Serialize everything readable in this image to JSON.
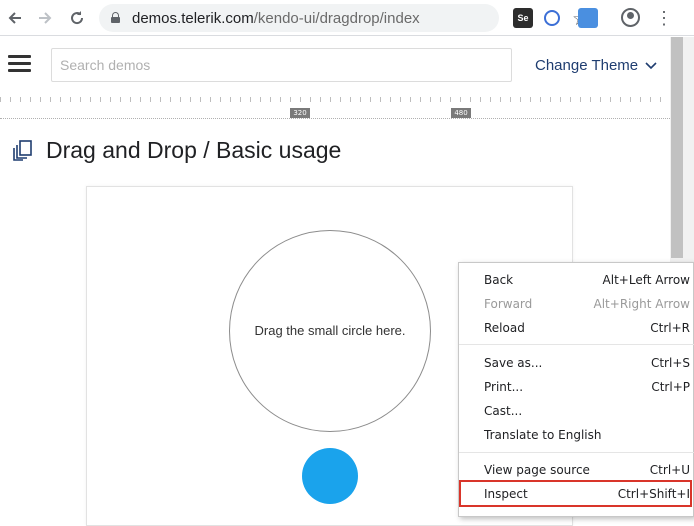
{
  "browser": {
    "url_host": "demos.telerik.com",
    "url_path": "/kendo-ui/dragdrop/index"
  },
  "site_header": {
    "search_placeholder": "Search demos",
    "theme_label": "Change Theme"
  },
  "ruler": {
    "tag_1": "320",
    "tag_2": "480"
  },
  "page": {
    "title": "Drag and Drop / Basic usage",
    "drop_target_label": "Drag the small circle here."
  },
  "colors": {
    "draggable_circle": "#1aa3ec",
    "inspect_highlight": "#d9352a",
    "theme_link": "#1f3d70"
  },
  "context_menu": {
    "items": [
      {
        "label": "Back",
        "shortcut": "Alt+Left Arrow",
        "disabled": false
      },
      {
        "label": "Forward",
        "shortcut": "Alt+Right Arrow",
        "disabled": true
      },
      {
        "label": "Reload",
        "shortcut": "Ctrl+R",
        "disabled": false
      },
      {
        "label": "Save as...",
        "shortcut": "Ctrl+S",
        "disabled": false
      },
      {
        "label": "Print...",
        "shortcut": "Ctrl+P",
        "disabled": false
      },
      {
        "label": "Cast...",
        "shortcut": "",
        "disabled": false
      },
      {
        "label": "Translate to English",
        "shortcut": "",
        "disabled": false
      },
      {
        "label": "View page source",
        "shortcut": "Ctrl+U",
        "disabled": false
      },
      {
        "label": "Inspect",
        "shortcut": "Ctrl+Shift+I",
        "disabled": false
      }
    ]
  },
  "icons": {
    "back": "arrow-left-icon",
    "forward": "arrow-right-icon",
    "reload": "reload-icon",
    "lock": "lock-icon",
    "bookmark": "star-icon",
    "menu": "hamburger-icon",
    "theme_dropdown": "chevron-down-icon",
    "page": "copy-pages-icon"
  }
}
